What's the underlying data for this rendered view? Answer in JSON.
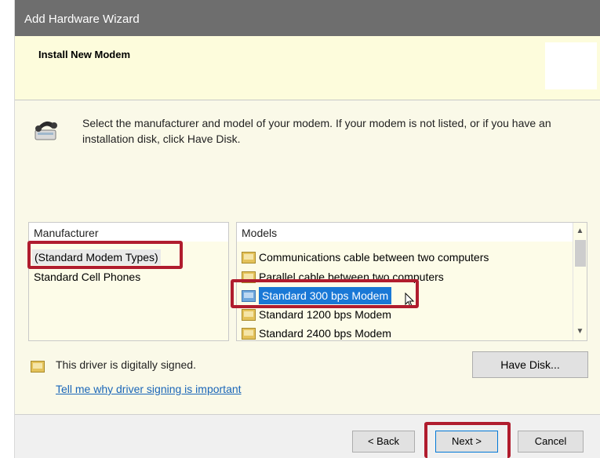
{
  "window": {
    "title": "Add Hardware Wizard"
  },
  "header": {
    "title": "Install New Modem"
  },
  "intro": {
    "icon": "modem-phone-icon",
    "text": "Select the manufacturer and model of your modem. If your modem is not listed, or if you have an installation disk, click Have Disk."
  },
  "manufacturer": {
    "header": "Manufacturer",
    "items": [
      "(Standard Modem Types)",
      "Standard Cell Phones"
    ],
    "selected": "(Standard Modem Types)"
  },
  "models": {
    "header": "Models",
    "items": [
      "Communications cable between two computers",
      "Parallel cable between two computers",
      "Standard  300 bps Modem",
      "Standard  1200 bps Modem",
      "Standard  2400 bps Modem"
    ],
    "selected": "Standard  300 bps Modem"
  },
  "signing": {
    "icon": "driver-signed-icon",
    "status_text": "This driver is digitally signed.",
    "link_text": "Tell me why driver signing is important"
  },
  "buttons": {
    "have_disk": "Have Disk...",
    "back": "< Back",
    "next": "Next >",
    "cancel": "Cancel"
  },
  "colors": {
    "highlight_box": "#b01c2e",
    "selection": "#1978d6",
    "link": "#1a66b8",
    "title_bar": "#6e6e6e"
  }
}
